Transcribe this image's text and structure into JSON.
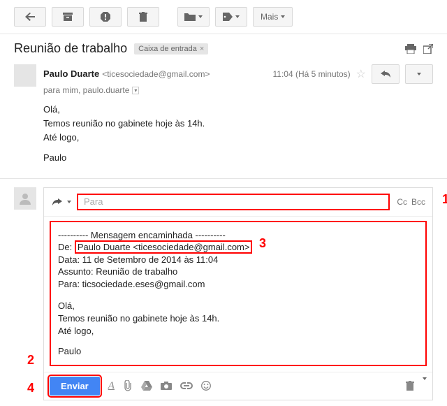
{
  "toolbar": {
    "more_label": "Mais"
  },
  "subject": {
    "text": "Reunião de trabalho",
    "label": "Caixa de entrada"
  },
  "message": {
    "sender_name": "Paulo Duarte",
    "sender_email": "<ticesociedade@gmail.com>",
    "to_line": "para mim, paulo.duarte",
    "time": "11:04 (Há 5 minutos)",
    "body_l1": "Olá,",
    "body_l2": "Temos reunião no gabinete hoje às 14h.",
    "body_l3": "Até logo,",
    "body_sig": "Paulo"
  },
  "compose": {
    "to_placeholder": "Para",
    "cc": "Cc",
    "bcc": "Bcc",
    "fwd_sep": "---------- Mensagem encaminhada ----------",
    "from_label": "De:",
    "from_value": "Paulo Duarte <ticesociedade@gmail.com>",
    "date_line": "Data: 11 de Setembro de 2014 às 11:04",
    "subject_line": "Assunto: Reunião de trabalho",
    "to_line": "Para: ticsociedade.eses@gmail.com",
    "body_l1": "Olá,",
    "body_l2": "Temos reunião no gabinete hoje às 14h.",
    "body_l3": "Até logo,",
    "body_sig": "Paulo",
    "send_label": "Enviar"
  },
  "annotations": {
    "n1": "1",
    "n2": "2",
    "n3": "3",
    "n4": "4"
  }
}
